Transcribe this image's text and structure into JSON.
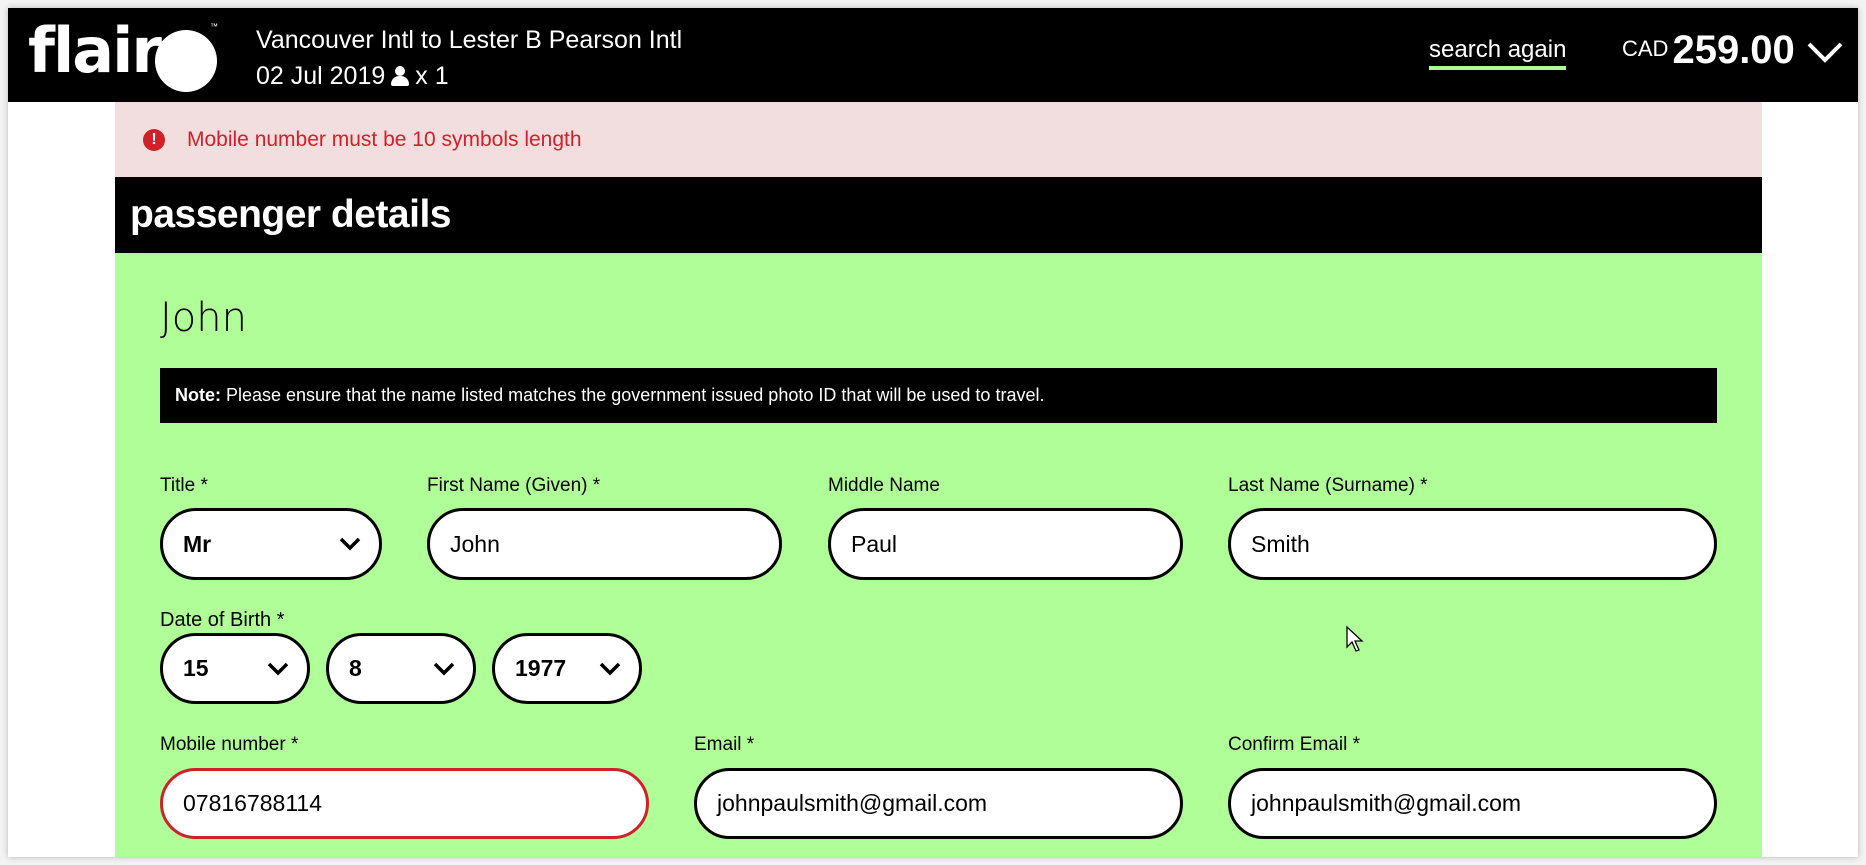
{
  "header": {
    "logo": "flair",
    "logo_tm": "™",
    "route": "Vancouver Intl to Lester B Pearson Intl",
    "date": "02 Jul 2019",
    "passenger_icon": "person-icon",
    "passenger_count": "x 1",
    "search_again": "search again",
    "currency": "CAD",
    "price": "259.00",
    "price_toggle_icon": "chevron-down-icon"
  },
  "error": {
    "icon": "exclamation-circle-icon",
    "icon_glyph": "!",
    "message": "Mobile number must be 10 symbols length"
  },
  "section": {
    "title": "passenger details"
  },
  "passenger": {
    "name": "John",
    "note_label": "Note:",
    "note_text": "Please ensure that the name listed matches the government issued photo ID that will be used to travel.",
    "fields": {
      "title": {
        "label": "Title *",
        "value": "Mr"
      },
      "first_name": {
        "label": "First Name (Given) *",
        "value": "John"
      },
      "middle_name": {
        "label": "Middle Name",
        "value": "Paul"
      },
      "last_name": {
        "label": "Last Name (Surname) *",
        "value": "Smith"
      },
      "dob": {
        "label": "Date of Birth *",
        "day": "15",
        "month": "8",
        "year": "1977"
      },
      "mobile": {
        "label": "Mobile number *",
        "value": "07816788114"
      },
      "email": {
        "label": "Email *",
        "value": "johnpaulsmith@gmail.com"
      },
      "confirm_email": {
        "label": "Confirm Email *",
        "value": "johnpaulsmith@gmail.com"
      }
    }
  },
  "colors": {
    "brand_green": "#b0fe98",
    "underline_green": "#adfc94",
    "error_red": "#d0202a",
    "error_bg": "#f2dede",
    "black": "#000000"
  }
}
